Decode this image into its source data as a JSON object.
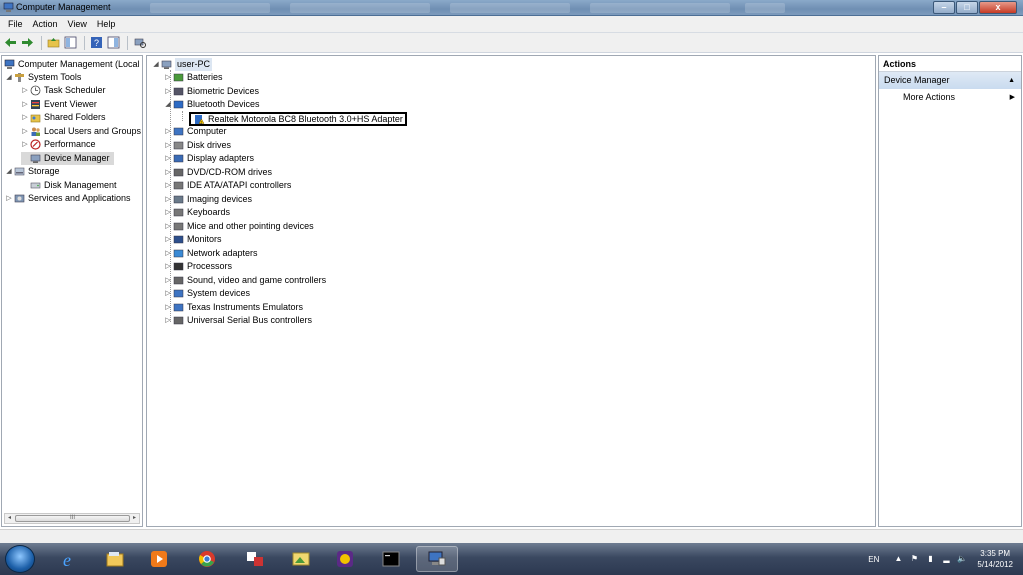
{
  "window": {
    "title": "Computer Management",
    "controls": {
      "minimize": "–",
      "maximize": "□",
      "close": "x"
    }
  },
  "menu": [
    "File",
    "Action",
    "View",
    "Help"
  ],
  "left_tree": {
    "root": "Computer Management (Local",
    "items": [
      {
        "label": "System Tools",
        "level": 1,
        "expanded": true,
        "icon": "tools-icon"
      },
      {
        "label": "Task Scheduler",
        "level": 2,
        "icon": "clock-icon"
      },
      {
        "label": "Event Viewer",
        "level": 2,
        "icon": "event-viewer-icon"
      },
      {
        "label": "Shared Folders",
        "level": 2,
        "icon": "shared-folder-icon"
      },
      {
        "label": "Local Users and Groups",
        "level": 2,
        "icon": "users-icon"
      },
      {
        "label": "Performance",
        "level": 2,
        "icon": "performance-icon"
      },
      {
        "label": "Device Manager",
        "level": 2,
        "icon": "device-manager-icon",
        "selected": true
      },
      {
        "label": "Storage",
        "level": 1,
        "expanded": true,
        "icon": "storage-icon"
      },
      {
        "label": "Disk Management",
        "level": 2,
        "icon": "disk-icon"
      },
      {
        "label": "Services and Applications",
        "level": 1,
        "icon": "services-icon"
      }
    ],
    "scroll_thumb": "III"
  },
  "device_tree": {
    "root": "user-PC",
    "categories": [
      "Batteries",
      "Biometric Devices",
      "Bluetooth Devices",
      "Computer",
      "Disk drives",
      "Display adapters",
      "DVD/CD-ROM drives",
      "IDE ATA/ATAPI controllers",
      "Imaging devices",
      "Keyboards",
      "Mice and other pointing devices",
      "Monitors",
      "Network adapters",
      "Processors",
      "Sound, video and game controllers",
      "System devices",
      "Texas Instruments Emulators",
      "Universal Serial Bus controllers"
    ],
    "bluetooth_child": "Realtek Motorola BC8 Bluetooth 3.0+HS Adapter"
  },
  "actions": {
    "header": "Actions",
    "section": "Device Manager",
    "more": "More Actions"
  },
  "tray": {
    "lang": "EN",
    "time": "3:35 PM",
    "date": "5/14/2012"
  },
  "colors": {
    "taskbar": "#3a4860",
    "title_bar": "#7d9bbd",
    "action_section": "#c9dbef"
  }
}
